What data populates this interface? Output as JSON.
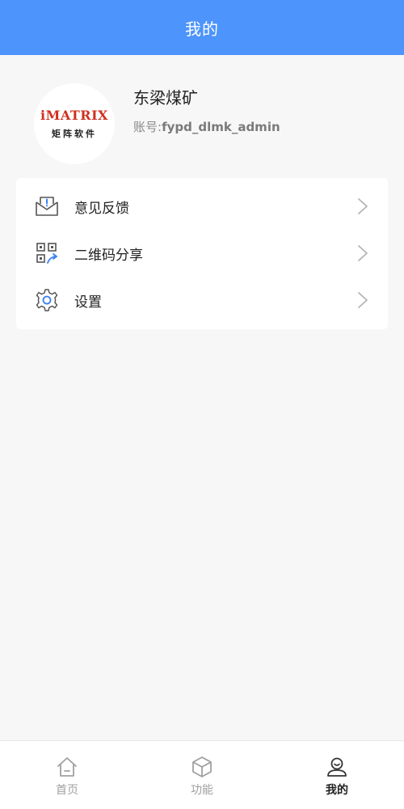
{
  "header": {
    "title": "我的"
  },
  "profile": {
    "avatar": {
      "logo_text": "iMATRIX",
      "logo_subtext": "矩阵软件"
    },
    "name": "东梁煤矿",
    "account_label": "账号:",
    "account_value": "fypd_dlmk_admin"
  },
  "menu": {
    "items": [
      {
        "label": "意见反馈",
        "icon": "feedback-mail-icon"
      },
      {
        "label": "二维码分享",
        "icon": "qrcode-share-icon"
      },
      {
        "label": "设置",
        "icon": "gear-icon"
      }
    ]
  },
  "tabbar": {
    "items": [
      {
        "label": "首页",
        "icon": "home-icon",
        "active": false
      },
      {
        "label": "功能",
        "icon": "cube-icon",
        "active": false
      },
      {
        "label": "我的",
        "icon": "user-icon",
        "active": true
      }
    ]
  },
  "colors": {
    "header_bg": "#4d94fc",
    "page_bg": "#f7f7f7",
    "logo_red": "#d0301f",
    "tab_active": "#222222",
    "tab_inactive": "#a0a0a0"
  }
}
